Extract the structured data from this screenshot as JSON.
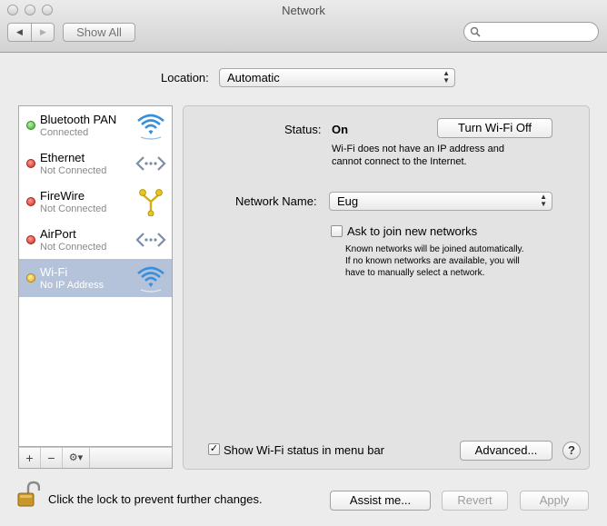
{
  "window": {
    "title": "Network"
  },
  "toolbar": {
    "back_icon": "triangle-left",
    "forward_icon": "triangle-right",
    "show_all_label": "Show All",
    "search_placeholder": ""
  },
  "location": {
    "label": "Location:",
    "value": "Automatic"
  },
  "services": [
    {
      "name": "Bluetooth PAN",
      "status": "Connected",
      "status_color": "#4dc43c",
      "icon": "wifi-icon",
      "selected": false
    },
    {
      "name": "Ethernet",
      "status": "Not Connected",
      "status_color": "#e0302a",
      "icon": "ethernet-icon",
      "selected": false
    },
    {
      "name": "FireWire",
      "status": "Not Connected",
      "status_color": "#e0302a",
      "icon": "firewire-icon",
      "selected": false
    },
    {
      "name": "AirPort",
      "status": "Not Connected",
      "status_color": "#e0302a",
      "icon": "ethernet-icon",
      "selected": false
    },
    {
      "name": "Wi-Fi",
      "status": "No IP Address",
      "status_color": "#f0c020",
      "icon": "wifi-icon",
      "selected": true
    }
  ],
  "sidebar_buttons": {
    "add": "+",
    "remove": "−",
    "action_icon": "gear-icon"
  },
  "detail": {
    "status_label": "Status:",
    "status_value": "On",
    "toggle_button": "Turn Wi-Fi Off",
    "status_desc_line1": "Wi-Fi does not have an IP address and",
    "status_desc_line2": "cannot connect to the Internet.",
    "network_name_label": "Network Name:",
    "network_name_value": "Eug",
    "ask_join_label": "Ask to join new networks",
    "ask_join_checked": false,
    "ask_join_desc_line1": "Known networks will be joined automatically.",
    "ask_join_desc_line2": "If no known networks are available, you will",
    "ask_join_desc_line3": "have to manually select a network.",
    "show_status_label": "Show Wi-Fi status in menu bar",
    "show_status_checked": true,
    "advanced_button": "Advanced...",
    "help_button": "?"
  },
  "footer": {
    "lock_text": "Click the lock to prevent further changes.",
    "assist_button": "Assist me...",
    "revert_button": "Revert",
    "apply_button": "Apply"
  },
  "colors": {
    "selection": "#b5c3da",
    "wifi_blue": "#3a8fdc",
    "firewire_yellow": "#e8c61e"
  }
}
